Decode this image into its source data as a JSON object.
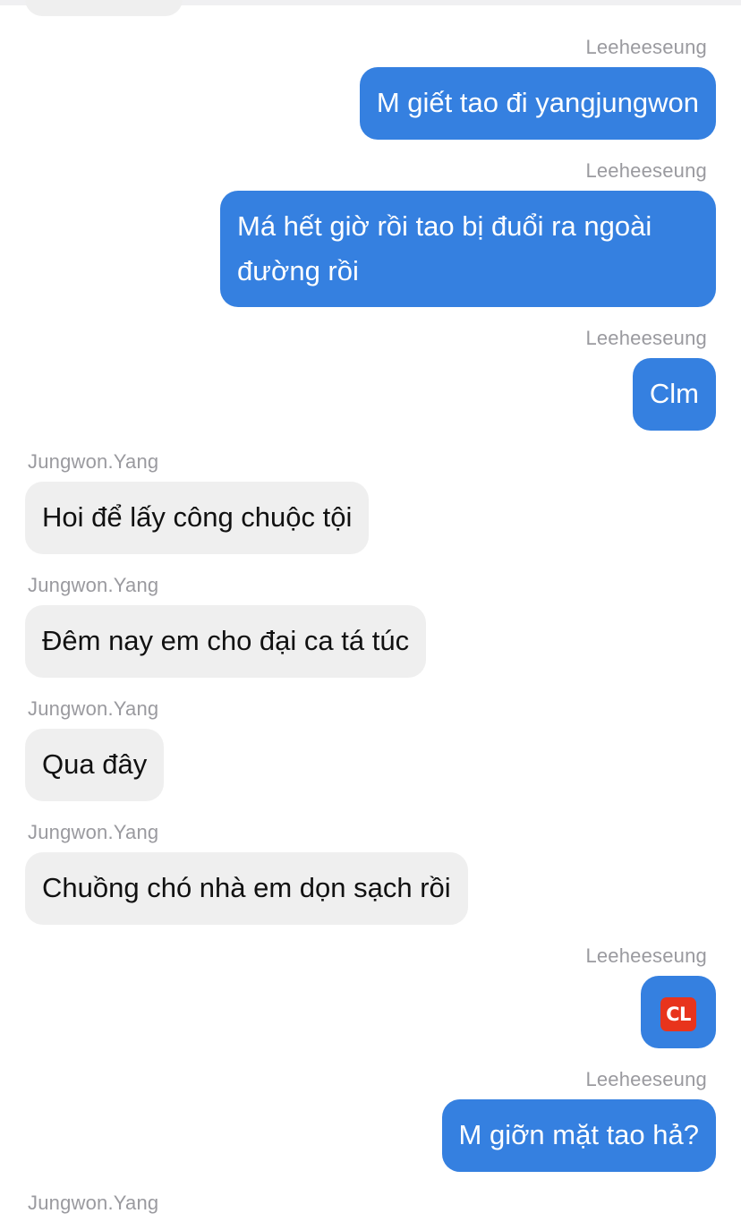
{
  "conversation": {
    "me": "Leeheeseung",
    "them": "Jungwon.Yang"
  },
  "messages": [
    {
      "sender": "Leeheeseung",
      "text": "M giết tao đi yangjungwon",
      "direction": "outgoing"
    },
    {
      "sender": "Leeheeseung",
      "text": "Má hết giờ rồi tao bị đuổi ra ngoài đường rồi",
      "direction": "outgoing"
    },
    {
      "sender": "Leeheeseung",
      "text": "Clm",
      "direction": "outgoing"
    },
    {
      "sender": "Jungwon.Yang",
      "text": "Hoi để lấy công chuộc tội",
      "direction": "incoming"
    },
    {
      "sender": "Jungwon.Yang",
      "text": "Đêm nay em cho đại ca tá túc",
      "direction": "incoming"
    },
    {
      "sender": "Jungwon.Yang",
      "text": "Qua đây",
      "direction": "incoming"
    },
    {
      "sender": "Jungwon.Yang",
      "text": "Chuồng chó nhà em dọn sạch rồi",
      "direction": "incoming"
    },
    {
      "sender": "Leeheeseung",
      "text": "CL",
      "emoji": "cl-button-icon",
      "direction": "outgoing"
    },
    {
      "sender": "Leeheeseung",
      "text": "M giỡn mặt tao hả?",
      "direction": "outgoing"
    },
    {
      "sender": "Jungwon.Yang",
      "direction": "incoming"
    }
  ],
  "colors": {
    "outgoing_bubble": "#3580e0",
    "incoming_bubble": "#efefef",
    "sender_label": "#9a9a9f",
    "cl_emoji": "#e8341c"
  }
}
